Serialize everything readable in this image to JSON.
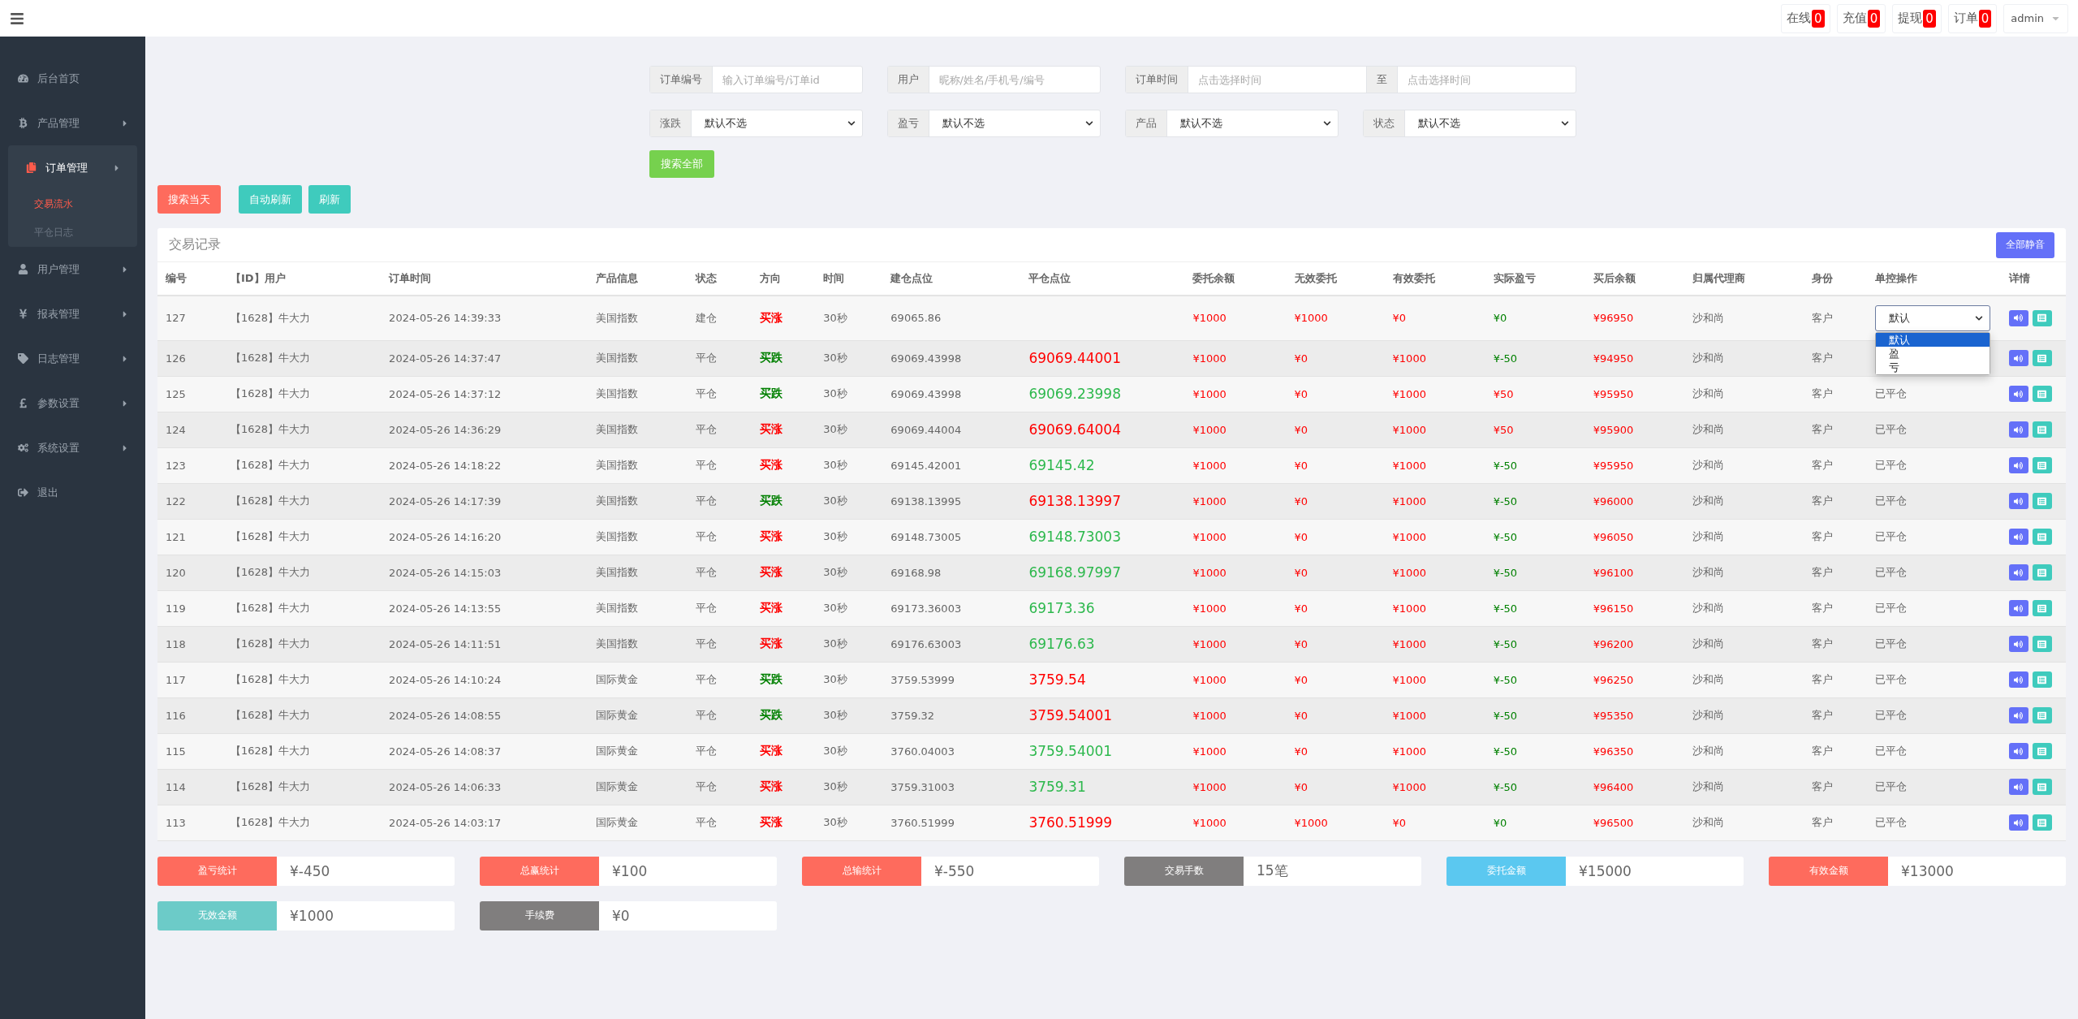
{
  "topbar": {
    "counters": [
      {
        "label": "在线",
        "count": "0"
      },
      {
        "label": "充值",
        "count": "0"
      },
      {
        "label": "提现",
        "count": "0"
      },
      {
        "label": "订单",
        "count": "0"
      }
    ],
    "user": "admin"
  },
  "sidebar": {
    "items": [
      {
        "label": "后台首页",
        "kind": "link",
        "selected": false
      },
      {
        "label": "产品管理",
        "kind": "menu",
        "selected": false
      },
      {
        "label": "订单管理",
        "kind": "menu",
        "selected": true,
        "expanded": true,
        "children": [
          {
            "label": "交易流水",
            "selected": true
          },
          {
            "label": "平仓日志",
            "selected": false
          }
        ]
      },
      {
        "label": "用户管理",
        "kind": "menu",
        "selected": false
      },
      {
        "label": "报表管理",
        "kind": "menu",
        "selected": false
      },
      {
        "label": "日志管理",
        "kind": "menu",
        "selected": false
      },
      {
        "label": "参数设置",
        "kind": "menu",
        "selected": false
      },
      {
        "label": "系统设置",
        "kind": "menu",
        "selected": false
      },
      {
        "label": "退出",
        "kind": "link",
        "selected": false
      }
    ]
  },
  "filters": {
    "fields": [
      {
        "kind": "text",
        "label": "订单编号",
        "placeholder": "输入订单编号/订单id"
      },
      {
        "kind": "text",
        "label": "用户",
        "placeholder": "昵称/姓名/手机号/编号"
      },
      {
        "kind": "range",
        "label": "订单时间",
        "placeholder": "点击选择时间",
        "separator": "至",
        "placeholder_end": "点击选择时间"
      },
      {
        "kind": "select",
        "label": "涨跌",
        "value": "默认不选"
      },
      {
        "kind": "select",
        "label": "盈亏",
        "value": "默认不选"
      },
      {
        "kind": "select",
        "label": "产品",
        "value": "默认不选"
      },
      {
        "kind": "select",
        "label": "状态",
        "value": "默认不选"
      }
    ],
    "search_button": "搜索全部"
  },
  "actions": [
    {
      "label": "搜索当天",
      "color": "#fe6b5d"
    },
    {
      "label": "自动刷新",
      "color": "#3fcbbd"
    },
    {
      "label": "刷新",
      "color": "#3fcbbd"
    }
  ],
  "table": {
    "title": "交易记录",
    "mute_button": "全部静音",
    "columns": [
      "编号",
      "【ID】用户",
      "订单时间",
      "产品信息",
      "状态",
      "方向",
      "时间",
      "建仓点位",
      "平仓点位",
      "委托余额",
      "无效委托",
      "有效委托",
      "实际盈亏",
      "买后余额",
      "归属代理商",
      "身份",
      "单控操作",
      "详情"
    ],
    "rows": [
      {
        "id": "127",
        "user": "【1628】牛大力",
        "time": "2024-05-26 14:39:33",
        "product": "美国指数",
        "status": "建仓",
        "direction": {
          "text": "买涨",
          "color": "#ff0000"
        },
        "duration": "30秒",
        "open": "69065.86",
        "entrust": "¥1000",
        "invalid": "¥1000",
        "valid": "¥0",
        "pnl": {
          "text": "¥0",
          "color": "#008000"
        },
        "balance": "¥96950",
        "agent": "沙和尚",
        "identity": "客户",
        "control": {
          "kind": "select",
          "value": "默认",
          "expanded": true,
          "options": [
            {
              "label": "默认",
              "selected": true
            },
            {
              "label": "盈",
              "selected": false
            },
            {
              "label": "亏",
              "selected": false
            }
          ]
        }
      },
      {
        "id": "126",
        "user": "【1628】牛大力",
        "time": "2024-05-26 14:37:47",
        "product": "美国指数",
        "status": "平仓",
        "direction": {
          "text": "买跌",
          "color": "#008000"
        },
        "duration": "30秒",
        "open": "69069.43998",
        "close": {
          "text": "69069.44001",
          "color": "#ff0000"
        },
        "entrust": "¥1000",
        "invalid": "¥0",
        "valid": "¥1000",
        "pnl": {
          "text": "¥-50",
          "color": "#008000"
        },
        "balance": "¥94950",
        "agent": "沙和尚",
        "identity": "客户"
      },
      {
        "id": "125",
        "user": "【1628】牛大力",
        "time": "2024-05-26 14:37:12",
        "product": "美国指数",
        "status": "平仓",
        "direction": {
          "text": "买跌",
          "color": "#008000"
        },
        "duration": "30秒",
        "open": "69069.43998",
        "close": {
          "text": "69069.23998",
          "color": "#2db84d"
        },
        "entrust": "¥1000",
        "invalid": "¥0",
        "valid": "¥1000",
        "pnl": {
          "text": "¥50",
          "color": "#ff0000"
        },
        "balance": "¥95950",
        "agent": "沙和尚",
        "identity": "客户",
        "control": {
          "kind": "text",
          "value": "已平仓"
        }
      },
      {
        "id": "124",
        "user": "【1628】牛大力",
        "time": "2024-05-26 14:36:29",
        "product": "美国指数",
        "status": "平仓",
        "direction": {
          "text": "买涨",
          "color": "#ff0000"
        },
        "duration": "30秒",
        "open": "69069.44004",
        "close": {
          "text": "69069.64004",
          "color": "#ff0000"
        },
        "entrust": "¥1000",
        "invalid": "¥0",
        "valid": "¥1000",
        "pnl": {
          "text": "¥50",
          "color": "#ff0000"
        },
        "balance": "¥95900",
        "agent": "沙和尚",
        "identity": "客户",
        "control": {
          "kind": "text",
          "value": "已平仓"
        }
      },
      {
        "id": "123",
        "user": "【1628】牛大力",
        "time": "2024-05-26 14:18:22",
        "product": "美国指数",
        "status": "平仓",
        "direction": {
          "text": "买涨",
          "color": "#ff0000"
        },
        "duration": "30秒",
        "open": "69145.42001",
        "close": {
          "text": "69145.42",
          "color": "#2db84d"
        },
        "entrust": "¥1000",
        "invalid": "¥0",
        "valid": "¥1000",
        "pnl": {
          "text": "¥-50",
          "color": "#008000"
        },
        "balance": "¥95950",
        "agent": "沙和尚",
        "identity": "客户",
        "control": {
          "kind": "text",
          "value": "已平仓"
        }
      },
      {
        "id": "122",
        "user": "【1628】牛大力",
        "time": "2024-05-26 14:17:39",
        "product": "美国指数",
        "status": "平仓",
        "direction": {
          "text": "买跌",
          "color": "#008000"
        },
        "duration": "30秒",
        "open": "69138.13995",
        "close": {
          "text": "69138.13997",
          "color": "#ff0000"
        },
        "entrust": "¥1000",
        "invalid": "¥0",
        "valid": "¥1000",
        "pnl": {
          "text": "¥-50",
          "color": "#008000"
        },
        "balance": "¥96000",
        "agent": "沙和尚",
        "identity": "客户",
        "control": {
          "kind": "text",
          "value": "已平仓"
        }
      },
      {
        "id": "121",
        "user": "【1628】牛大力",
        "time": "2024-05-26 14:16:20",
        "product": "美国指数",
        "status": "平仓",
        "direction": {
          "text": "买涨",
          "color": "#ff0000"
        },
        "duration": "30秒",
        "open": "69148.73005",
        "close": {
          "text": "69148.73003",
          "color": "#2db84d"
        },
        "entrust": "¥1000",
        "invalid": "¥0",
        "valid": "¥1000",
        "pnl": {
          "text": "¥-50",
          "color": "#008000"
        },
        "balance": "¥96050",
        "agent": "沙和尚",
        "identity": "客户",
        "control": {
          "kind": "text",
          "value": "已平仓"
        }
      },
      {
        "id": "120",
        "user": "【1628】牛大力",
        "time": "2024-05-26 14:15:03",
        "product": "美国指数",
        "status": "平仓",
        "direction": {
          "text": "买涨",
          "color": "#ff0000"
        },
        "duration": "30秒",
        "open": "69168.98",
        "close": {
          "text": "69168.97997",
          "color": "#2db84d"
        },
        "entrust": "¥1000",
        "invalid": "¥0",
        "valid": "¥1000",
        "pnl": {
          "text": "¥-50",
          "color": "#008000"
        },
        "balance": "¥96100",
        "agent": "沙和尚",
        "identity": "客户",
        "control": {
          "kind": "text",
          "value": "已平仓"
        }
      },
      {
        "id": "119",
        "user": "【1628】牛大力",
        "time": "2024-05-26 14:13:55",
        "product": "美国指数",
        "status": "平仓",
        "direction": {
          "text": "买涨",
          "color": "#ff0000"
        },
        "duration": "30秒",
        "open": "69173.36003",
        "close": {
          "text": "69173.36",
          "color": "#2db84d"
        },
        "entrust": "¥1000",
        "invalid": "¥0",
        "valid": "¥1000",
        "pnl": {
          "text": "¥-50",
          "color": "#008000"
        },
        "balance": "¥96150",
        "agent": "沙和尚",
        "identity": "客户",
        "control": {
          "kind": "text",
          "value": "已平仓"
        }
      },
      {
        "id": "118",
        "user": "【1628】牛大力",
        "time": "2024-05-26 14:11:51",
        "product": "美国指数",
        "status": "平仓",
        "direction": {
          "text": "买涨",
          "color": "#ff0000"
        },
        "duration": "30秒",
        "open": "69176.63003",
        "close": {
          "text": "69176.63",
          "color": "#2db84d"
        },
        "entrust": "¥1000",
        "invalid": "¥0",
        "valid": "¥1000",
        "pnl": {
          "text": "¥-50",
          "color": "#008000"
        },
        "balance": "¥96200",
        "agent": "沙和尚",
        "identity": "客户",
        "control": {
          "kind": "text",
          "value": "已平仓"
        }
      },
      {
        "id": "117",
        "user": "【1628】牛大力",
        "time": "2024-05-26 14:10:24",
        "product": "国际黄金",
        "status": "平仓",
        "direction": {
          "text": "买跌",
          "color": "#008000"
        },
        "duration": "30秒",
        "open": "3759.53999",
        "close": {
          "text": "3759.54",
          "color": "#ff0000"
        },
        "entrust": "¥1000",
        "invalid": "¥0",
        "valid": "¥1000",
        "pnl": {
          "text": "¥-50",
          "color": "#008000"
        },
        "balance": "¥96250",
        "agent": "沙和尚",
        "identity": "客户",
        "control": {
          "kind": "text",
          "value": "已平仓"
        }
      },
      {
        "id": "116",
        "user": "【1628】牛大力",
        "time": "2024-05-26 14:08:55",
        "product": "国际黄金",
        "status": "平仓",
        "direction": {
          "text": "买跌",
          "color": "#008000"
        },
        "duration": "30秒",
        "open": "3759.32",
        "close": {
          "text": "3759.54001",
          "color": "#ff0000"
        },
        "entrust": "¥1000",
        "invalid": "¥0",
        "valid": "¥1000",
        "pnl": {
          "text": "¥-50",
          "color": "#008000"
        },
        "balance": "¥95350",
        "agent": "沙和尚",
        "identity": "客户",
        "control": {
          "kind": "text",
          "value": "已平仓"
        }
      },
      {
        "id": "115",
        "user": "【1628】牛大力",
        "time": "2024-05-26 14:08:37",
        "product": "国际黄金",
        "status": "平仓",
        "direction": {
          "text": "买涨",
          "color": "#ff0000"
        },
        "duration": "30秒",
        "open": "3760.04003",
        "close": {
          "text": "3759.54001",
          "color": "#2db84d"
        },
        "entrust": "¥1000",
        "invalid": "¥0",
        "valid": "¥1000",
        "pnl": {
          "text": "¥-50",
          "color": "#008000"
        },
        "balance": "¥96350",
        "agent": "沙和尚",
        "identity": "客户",
        "control": {
          "kind": "text",
          "value": "已平仓"
        }
      },
      {
        "id": "114",
        "user": "【1628】牛大力",
        "time": "2024-05-26 14:06:33",
        "product": "国际黄金",
        "status": "平仓",
        "direction": {
          "text": "买涨",
          "color": "#ff0000"
        },
        "duration": "30秒",
        "open": "3759.31003",
        "close": {
          "text": "3759.31",
          "color": "#2db84d"
        },
        "entrust": "¥1000",
        "invalid": "¥0",
        "valid": "¥1000",
        "pnl": {
          "text": "¥-50",
          "color": "#008000"
        },
        "balance": "¥96400",
        "agent": "沙和尚",
        "identity": "客户",
        "control": {
          "kind": "text",
          "value": "已平仓"
        }
      },
      {
        "id": "113",
        "user": "【1628】牛大力",
        "time": "2024-05-26 14:03:17",
        "product": "国际黄金",
        "status": "平仓",
        "direction": {
          "text": "买涨",
          "color": "#ff0000"
        },
        "duration": "30秒",
        "open": "3760.51999",
        "close": {
          "text": "3760.51999",
          "color": "#ff0000"
        },
        "entrust": "¥1000",
        "invalid": "¥1000",
        "valid": "¥0",
        "pnl": {
          "text": "¥0",
          "color": "#008000"
        },
        "balance": "¥96500",
        "agent": "沙和尚",
        "identity": "客户",
        "control": {
          "kind": "text",
          "value": "已平仓"
        }
      }
    ]
  },
  "stats": [
    {
      "label": "盈亏统计",
      "value": "¥-450",
      "color": "#fe6b5d"
    },
    {
      "label": "总赢统计",
      "value": "¥100",
      "color": "#fe6b5d"
    },
    {
      "label": "总输统计",
      "value": "¥-550",
      "color": "#fe6b5d"
    },
    {
      "label": "交易手数",
      "value": "15笔",
      "color": "#807e7e"
    },
    {
      "label": "委托金额",
      "value": "¥15000",
      "color": "#5bc8f0"
    },
    {
      "label": "有效金额",
      "value": "¥13000",
      "color": "#fe6b5d"
    },
    {
      "label": "无效金额",
      "value": "¥1000",
      "color": "#6ccbc8"
    },
    {
      "label": "手续费",
      "value": "¥0",
      "color": "#807e7e"
    }
  ]
}
